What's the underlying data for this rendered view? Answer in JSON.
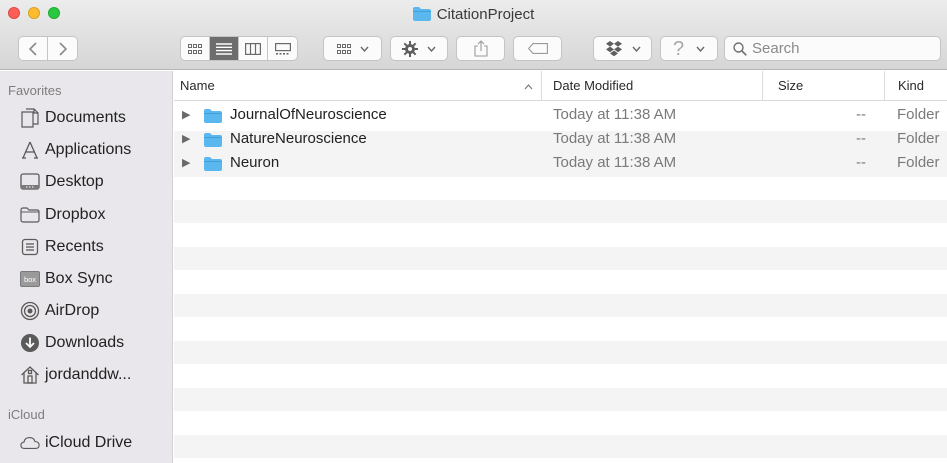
{
  "window": {
    "title": "CitationProject"
  },
  "toolbar": {
    "back_label": "<",
    "forward_label": ">",
    "search_placeholder": "Search"
  },
  "sidebar": {
    "favorites_heading": "Favorites",
    "favorites": [
      {
        "label": "Documents",
        "icon": "documents-icon"
      },
      {
        "label": "Applications",
        "icon": "applications-icon"
      },
      {
        "label": "Desktop",
        "icon": "desktop-icon"
      },
      {
        "label": "Dropbox",
        "icon": "folder-icon"
      },
      {
        "label": "Recents",
        "icon": "recents-icon"
      },
      {
        "label": "Box Sync",
        "icon": "box-icon"
      },
      {
        "label": "AirDrop",
        "icon": "airdrop-icon"
      },
      {
        "label": "Downloads",
        "icon": "downloads-icon"
      },
      {
        "label": "jordanddw...",
        "icon": "home-icon"
      }
    ],
    "icloud_heading": "iCloud",
    "icloud": [
      {
        "label": "iCloud Drive",
        "icon": "cloud-icon"
      }
    ]
  },
  "list": {
    "columns": {
      "name": "Name",
      "date_modified": "Date Modified",
      "size": "Size",
      "kind": "Kind"
    },
    "rows": [
      {
        "name": "JournalOfNeuroscience",
        "date": "Today at 11:38 AM",
        "size": "--",
        "kind": "Folder"
      },
      {
        "name": "NatureNeuroscience",
        "date": "Today at 11:38 AM",
        "size": "--",
        "kind": "Folder"
      },
      {
        "name": "Neuron",
        "date": "Today at 11:38 AM",
        "size": "--",
        "kind": "Folder"
      }
    ]
  },
  "colors": {
    "folder_blue": "#5ab8ef",
    "sidebar_bg": "#e9e7eb",
    "stripe": "#f4f4f5",
    "close": "#fc5f57",
    "minimize": "#fdbc2e",
    "maximize": "#28c840"
  }
}
